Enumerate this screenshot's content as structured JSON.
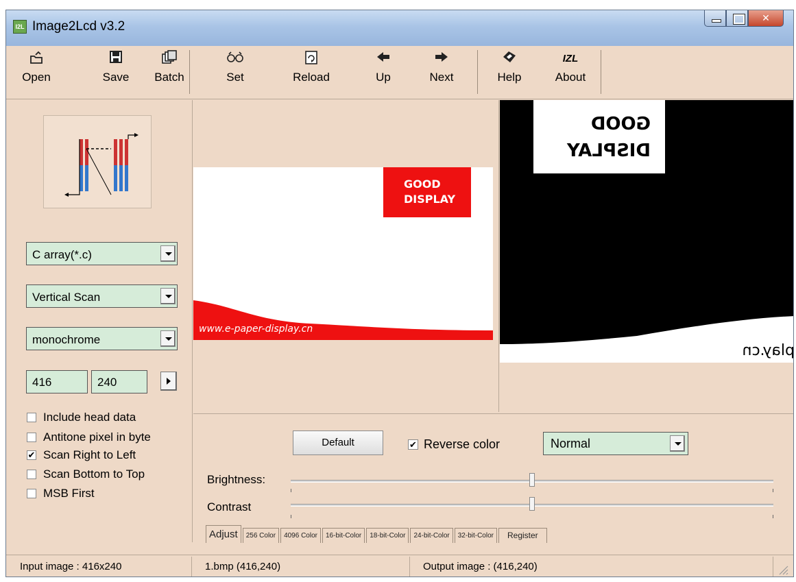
{
  "window": {
    "title": "Image2Lcd v3.2",
    "app_icon_text": "I2L"
  },
  "toolbar": {
    "open_label": "Open",
    "save_label": "Save",
    "batch_label": "Batch",
    "set_label": "Set",
    "reload_label": "Reload",
    "up_label": "Up",
    "next_label": "Next",
    "help_label": "Help",
    "about_label": "About",
    "about_icon_text": "IZL"
  },
  "left_panel": {
    "output_type": "C array(*.c)",
    "scan_mode": "Vertical Scan",
    "color_depth": "monochrome",
    "width": "416",
    "height": "240",
    "options": [
      {
        "label": "Include head data",
        "checked": false
      },
      {
        "label": "Antitone pixel in byte",
        "checked": false
      },
      {
        "label": "Scan Right to Left",
        "checked": true
      },
      {
        "label": "Scan Bottom to Top",
        "checked": false
      },
      {
        "label": "MSB First",
        "checked": false
      }
    ]
  },
  "preview": {
    "badge_line1": "GOOD",
    "badge_line2": "DISPLAY",
    "url_text": "www.e-paper-display.cn",
    "out_badge_line1": "GOOD",
    "out_badge_line2": "DISPLAY",
    "out_url_text": "play.cn"
  },
  "adjust": {
    "default_label": "Default",
    "reverse_color_label": "Reverse color",
    "reverse_color_checked": true,
    "mode_value": "Normal",
    "brightness_label": "Brightness:",
    "contrast_label": "Contrast",
    "brightness_value": 0.5,
    "contrast_value": 0.5,
    "tabs": [
      "Adjust",
      "256 Color",
      "4096 Color",
      "16-bit-Color",
      "18-bit-Color",
      "24-bit-Color",
      "32-bit-Color",
      "Register"
    ]
  },
  "status": {
    "input": "Input image : 416x240",
    "file": "1.bmp  (416,240)",
    "output": "Output image : (416,240)"
  },
  "colors": {
    "window_bg": "#eed9c7",
    "combo_bg": "#d6ecd9",
    "brand_red": "#ee1111"
  }
}
